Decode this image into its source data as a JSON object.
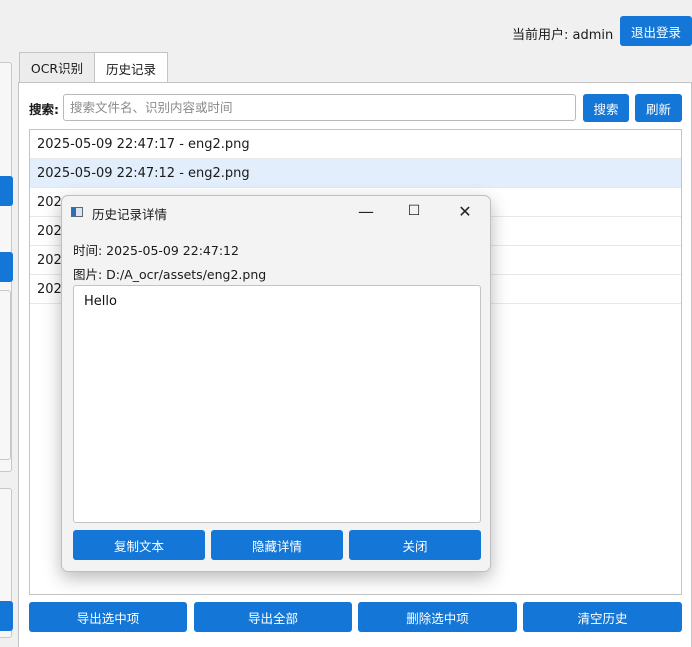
{
  "header": {
    "user_label": "当前用户: admin",
    "logout_label": "退出登录"
  },
  "tabs": [
    {
      "label": "OCR识别"
    },
    {
      "label": "历史记录"
    }
  ],
  "search": {
    "label": "搜索:",
    "placeholder": "搜索文件名、识别内容或时间",
    "value": "",
    "search_button": "搜索",
    "refresh_button": "刷新"
  },
  "history": {
    "items": [
      "2025-05-09 22:47:17 - eng2.png",
      "2025-05-09 22:47:12 - eng2.png",
      "202",
      "202",
      "202",
      "202"
    ],
    "selected_index": 1
  },
  "actions": {
    "export_selected": "导出选中项",
    "export_all": "导出全部",
    "delete_selected": "删除选中项",
    "clear_history": "清空历史"
  },
  "dialog": {
    "title": "历史记录详情",
    "minimize_glyph": "—",
    "maximize_glyph": "☐",
    "close_glyph": "✕",
    "time_line": "时间: 2025-05-09 22:47:12",
    "image_line": "图片: D:/A_ocr/assets/eng2.png",
    "text_content": "Hello",
    "copy_button": "复制文本",
    "hide_button": "隐藏详情",
    "close_button": "关闭"
  },
  "colors": {
    "accent": "#1476d6",
    "selected_row": "#e2eefb"
  }
}
